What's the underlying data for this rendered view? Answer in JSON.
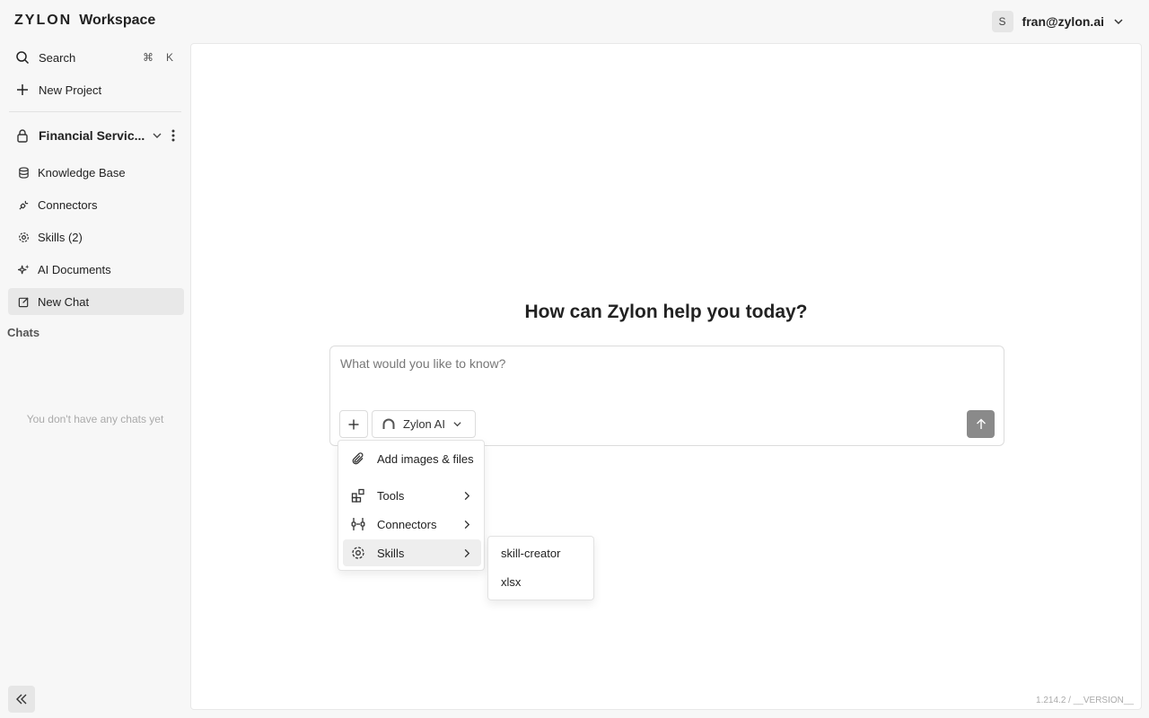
{
  "header": {
    "brand": "ZYLON",
    "workspace": "Workspace",
    "user_initial": "S",
    "user_email": "fran@zylon.ai"
  },
  "sidebar": {
    "search_label": "Search",
    "search_shortcut_cmd": "⌘",
    "search_shortcut_key": "K",
    "new_project_label": "New Project",
    "project_name": "Financial Servic...",
    "items": [
      {
        "label": "Knowledge Base",
        "icon": "database-icon"
      },
      {
        "label": "Connectors",
        "icon": "plug-icon"
      },
      {
        "label": "Skills (2)",
        "icon": "gear-icon"
      },
      {
        "label": "AI Documents",
        "icon": "sparkles-icon"
      },
      {
        "label": "New Chat",
        "icon": "edit-icon"
      }
    ],
    "chats_label": "Chats",
    "empty_chats": "You don't have any chats yet"
  },
  "main": {
    "headline": "How can Zylon help you today?",
    "composer_placeholder": "What would you like to know?",
    "model_label": "Zylon AI",
    "version": "1.214.2 / __VERSION__"
  },
  "menu": {
    "items": [
      {
        "label": "Add images & files",
        "icon": "paperclip-icon"
      },
      {
        "label": "Tools",
        "icon": "blocks-icon"
      },
      {
        "label": "Connectors",
        "icon": "plug-icon"
      },
      {
        "label": "Skills",
        "icon": "gear-icon"
      }
    ]
  },
  "submenu": {
    "items": [
      "skill-creator",
      "xlsx"
    ]
  },
  "colors": {
    "sidebar_bg": "#f7f7f7",
    "active_bg": "#e8e8e8",
    "send_button": "#8a8a8a"
  }
}
